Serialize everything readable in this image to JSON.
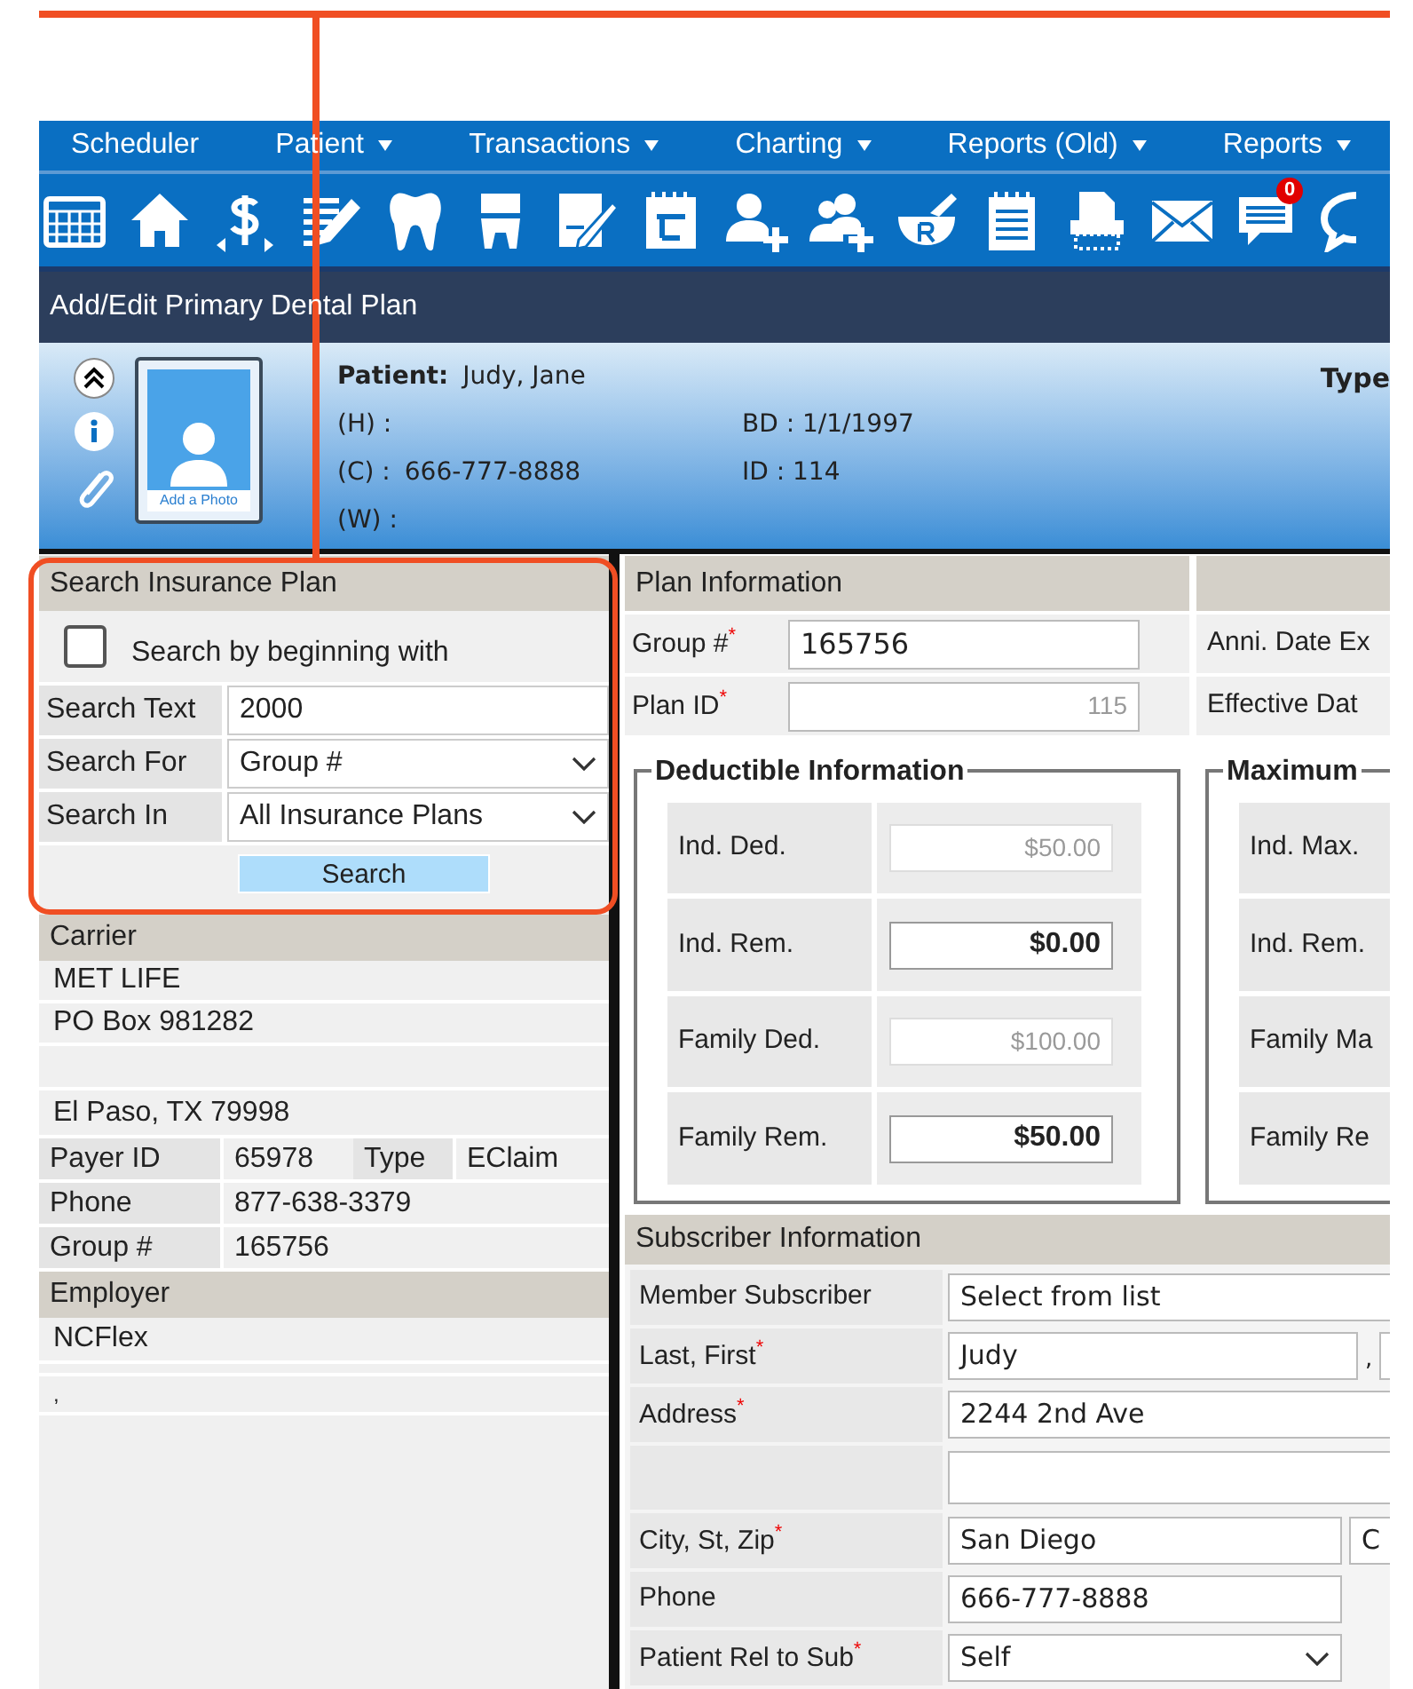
{
  "menu": [
    {
      "label": "Scheduler",
      "dropdown": false
    },
    {
      "label": "Patient",
      "dropdown": true
    },
    {
      "label": "Transactions",
      "dropdown": true
    },
    {
      "label": "Charting",
      "dropdown": true
    },
    {
      "label": "Reports (Old)",
      "dropdown": true
    },
    {
      "label": "Reports",
      "dropdown": true
    }
  ],
  "toolbar": {
    "badge": "0"
  },
  "title": "Add/Edit Primary Dental Plan",
  "patient": {
    "label": "Patient:",
    "name": "Judy, Jane",
    "home": "(H) :",
    "cell_label": "(C) :",
    "cell": "666-777-8888",
    "work": "(W) :",
    "birth_date": "BD : 1/1/1997",
    "id": "ID : 114",
    "type_label": "Type",
    "photo_caption": "Add a Photo"
  },
  "search": {
    "title": "Search Insurance Plan",
    "checkbox": {
      "label": "Search by beginning with",
      "checked": false
    },
    "fields": [
      {
        "label": "Search Text",
        "value": "2000",
        "kind": "text"
      },
      {
        "label": "Search For",
        "value": "Group #",
        "kind": "select"
      },
      {
        "label": "Search In",
        "value": "All Insurance Plans",
        "kind": "select"
      }
    ],
    "button": "Search"
  },
  "carrier": {
    "header": "Carrier",
    "name": "MET LIFE",
    "street": "PO Box 981282",
    "city": "El Paso, TX 79998",
    "payer": [
      {
        "label": "Payer ID",
        "value": "65978"
      },
      {
        "label": "Type",
        "value": "EClaim"
      }
    ],
    "rows": [
      {
        "label": "Phone",
        "value": "877-638-3379"
      },
      {
        "label": "Group #",
        "value": "165756"
      }
    ]
  },
  "employer": {
    "header": "Employer",
    "name": "NCFlex",
    "line": ","
  },
  "plan": {
    "header": "Plan Information",
    "fields": [
      {
        "label": "Group #",
        "mark": "*",
        "value": "165756",
        "disabled": false,
        "side_label": "Anni. Date Ex"
      },
      {
        "label": "Plan ID",
        "mark": "*",
        "value": "115",
        "disabled": true,
        "side_label": "Effective Dat"
      }
    ]
  },
  "deductible": {
    "title": "Deductible Information",
    "rows": [
      {
        "label": "Ind. Ded.",
        "value": "$50.00",
        "disabled": true
      },
      {
        "label": "Ind. Rem.",
        "value": "$0.00",
        "disabled": false
      },
      {
        "label": "Family Ded.",
        "value": "$100.00",
        "disabled": true
      },
      {
        "label": "Family Rem.",
        "value": "$50.00",
        "disabled": false
      }
    ]
  },
  "maximum": {
    "title": "Maximum",
    "labels": [
      "Ind. Max.",
      "Ind. Rem.",
      "Family Ma",
      "Family Re"
    ]
  },
  "subscriber": {
    "header": "Subscriber Information",
    "rows": [
      {
        "label": "Member Subscriber",
        "kind": "select",
        "value": "Select from list"
      },
      {
        "label": "Last, First",
        "mark": "*",
        "kind": "pair",
        "value": "Judy",
        "separator": ","
      },
      {
        "label": "Address",
        "mark": "*",
        "kind": "text",
        "value": "2244 2nd Ave"
      },
      {
        "kind": "text"
      },
      {
        "label": "City, St, Zip",
        "mark": "*",
        "kind": "pair",
        "value": "San Diego",
        "second": "C"
      },
      {
        "label": "Phone",
        "kind": "short",
        "value": "666-777-8888"
      },
      {
        "label": "Patient Rel to Sub",
        "mark": "*",
        "kind": "shortselect",
        "value": "Self"
      }
    ]
  }
}
